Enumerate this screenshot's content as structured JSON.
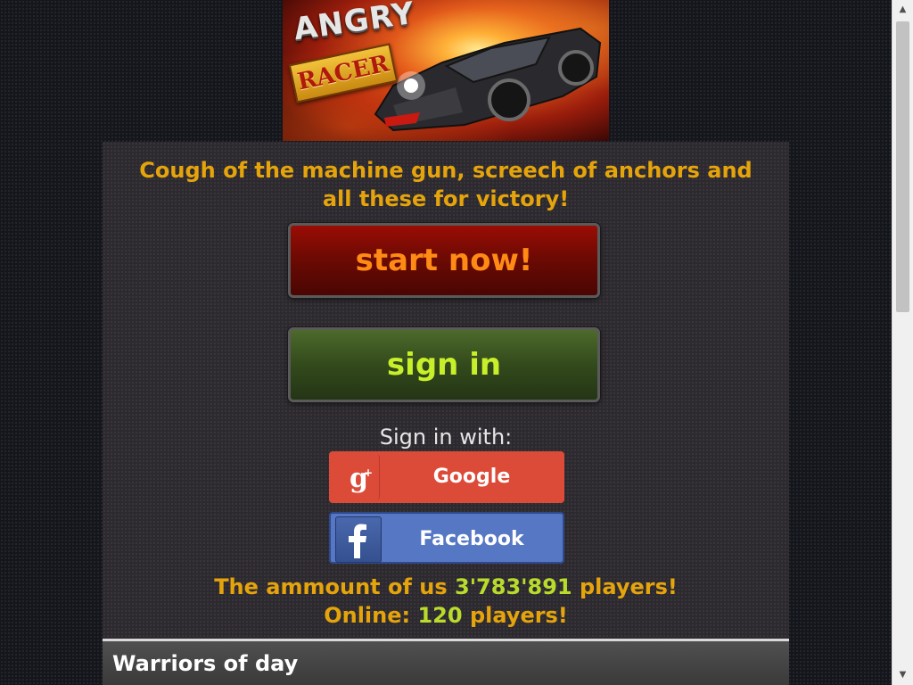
{
  "banner": {
    "logo_top": "ANGRY",
    "logo_bottom": "RACER"
  },
  "main": {
    "tagline_line1": "Cough of the machine gun, screech of anchors and",
    "tagline_line2": "all these for victory!",
    "start_label": "start now!",
    "signin_label": "sign in",
    "signin_with": "Sign in with:",
    "social": {
      "google_label": "Google",
      "facebook_label": "Facebook",
      "google_icon": "google-plus-icon",
      "facebook_icon": "facebook-icon"
    },
    "stats": {
      "players_prefix": "The ammount of us",
      "players_count": "3'783'891",
      "players_suffix": "players!",
      "online_prefix": "Online:",
      "online_count": "120",
      "online_suffix": "players!"
    }
  },
  "section": {
    "title": "Warriors of day"
  },
  "colors": {
    "accent_orange": "#e5a40b",
    "accent_lime": "#b9dc2c",
    "start_text": "#ff8a14",
    "signin_text": "#c7ef2a",
    "google": "#dc4a38",
    "facebook": "#5677c3"
  }
}
